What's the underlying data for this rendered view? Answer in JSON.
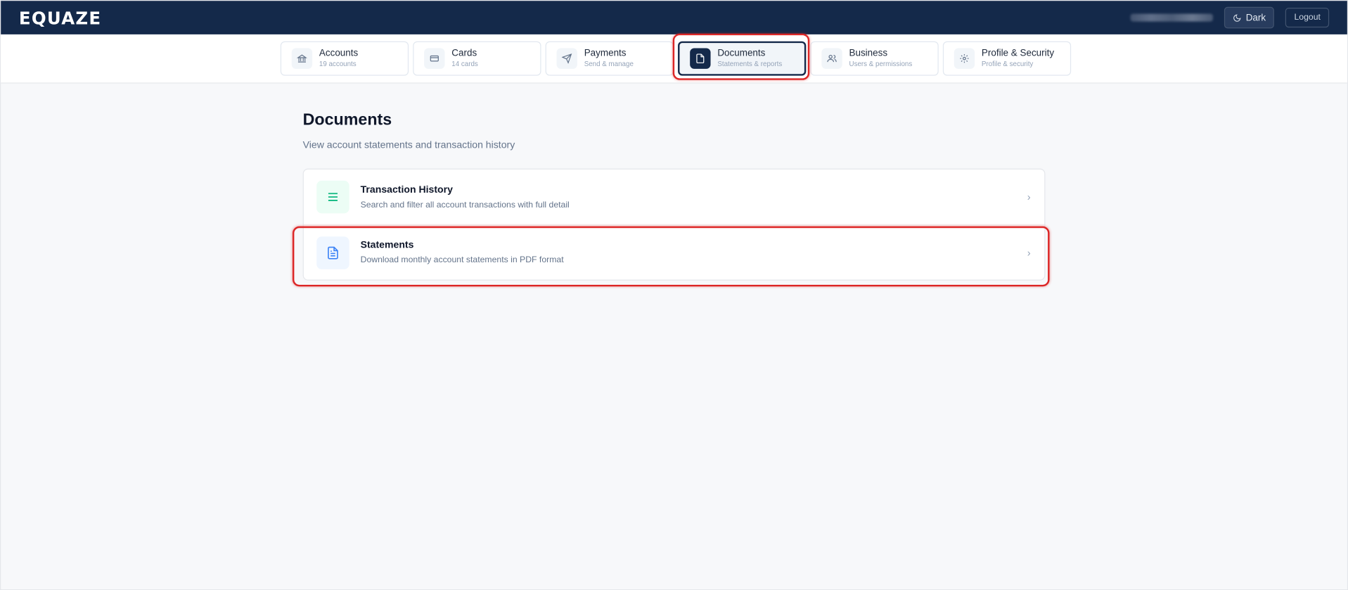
{
  "app": {
    "logo": "EQUAZE"
  },
  "header": {
    "dark_label": "Dark",
    "logout_label": "Logout"
  },
  "nav": {
    "tabs": [
      {
        "key": "accounts",
        "label": "Accounts",
        "sub": "19 accounts",
        "icon": "bank-icon"
      },
      {
        "key": "cards",
        "label": "Cards",
        "sub": "14 cards",
        "icon": "credit-card-icon"
      },
      {
        "key": "payments",
        "label": "Payments",
        "sub": "Send & manage",
        "icon": "send-icon"
      },
      {
        "key": "documents",
        "label": "Documents",
        "sub": "Statements & reports",
        "icon": "document-icon",
        "active": true
      },
      {
        "key": "business",
        "label": "Business",
        "sub": "Users & permissions",
        "icon": "users-icon"
      },
      {
        "key": "profile",
        "label": "Profile & Security",
        "sub": "Profile & security",
        "icon": "gear-icon"
      }
    ]
  },
  "main": {
    "title": "Documents",
    "subtitle": "View account statements and transaction history",
    "items": [
      {
        "title": "Transaction History",
        "description": "Search and filter all account transactions with full detail",
        "icon": "list-icon",
        "icon_color": "#10b981",
        "icon_bg": "#ecfdf5"
      },
      {
        "title": "Statements",
        "description": "Download monthly account statements in PDF format",
        "icon": "file-text-icon",
        "icon_color": "#3b82f6",
        "icon_bg": "#eff6ff"
      }
    ]
  },
  "colors": {
    "header_bg": "#14294a",
    "highlight": "#dc2626",
    "page_bg": "#f7f8fa"
  }
}
